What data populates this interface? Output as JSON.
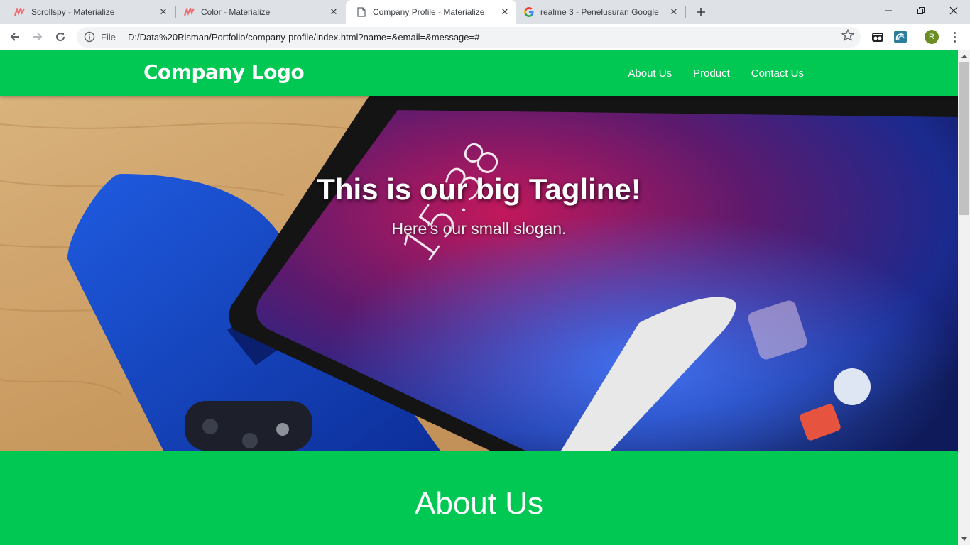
{
  "browser": {
    "tabs": [
      {
        "title": "Scrollspy - Materialize",
        "icon": "materialize-icon",
        "active": false
      },
      {
        "title": "Color - Materialize",
        "icon": "materialize-icon",
        "active": false
      },
      {
        "title": "Company Profile - Materialize",
        "icon": "page-icon",
        "active": true
      },
      {
        "title": "realme 3 - Penelusuran Google",
        "icon": "google-icon",
        "active": false
      }
    ],
    "omnibox": {
      "scheme_label": "File",
      "url": "D:/Data%20Risman/Portfolio/company-profile/index.html?name=&email=&message=#"
    },
    "profile_initial": "R"
  },
  "site": {
    "logo": "Company Logo",
    "nav": [
      "About Us",
      "Product",
      "Contact Us"
    ],
    "hero": {
      "tagline": "This is our big Tagline!",
      "slogan": "Here's our small slogan."
    },
    "about_title": "About Us"
  },
  "colors": {
    "brand_green": "#00c853",
    "tabstrip": "#dee1e6",
    "omnibox": "#f1f3f4"
  }
}
